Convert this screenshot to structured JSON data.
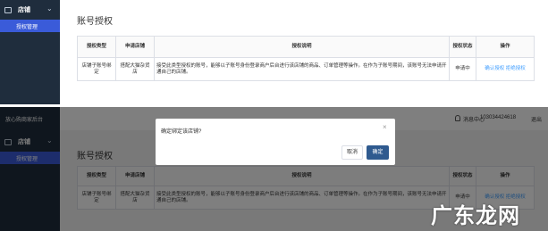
{
  "sidebar": {
    "section_label": "店铺",
    "item_label": "授权管理"
  },
  "page": {
    "title": "账号授权"
  },
  "table": {
    "headers": [
      "授权类型",
      "申请店铺",
      "授权说明",
      "授权状态",
      "操作"
    ],
    "row": {
      "type": "店铺子账号绑定",
      "shop": "搭配大猫杂货店",
      "desc": "接受此类型授权的账号，能够以子账号身份登录商户后台进行该店铺的商品、订单管理等操作。在作为子账号期间，该账号无法申请开通自己的店铺。",
      "status": "申请中",
      "action_accept": "确认授权",
      "action_reject": "拒绝授权"
    }
  },
  "topbar": {
    "brand": "放心购商家后台",
    "messages": "消息中心",
    "phone": "103034424618",
    "logout": "退出"
  },
  "dialog": {
    "title": "确定绑定该店铺?",
    "cancel": "取消",
    "ok": "确定"
  },
  "watermark": {
    "text": "广东龙网"
  },
  "colors": {
    "sidebar_bg": "#1f2d3d",
    "sidebar_active": "#3a5bd9",
    "link": "#409eff",
    "primary_button": "#2f5a8f"
  }
}
